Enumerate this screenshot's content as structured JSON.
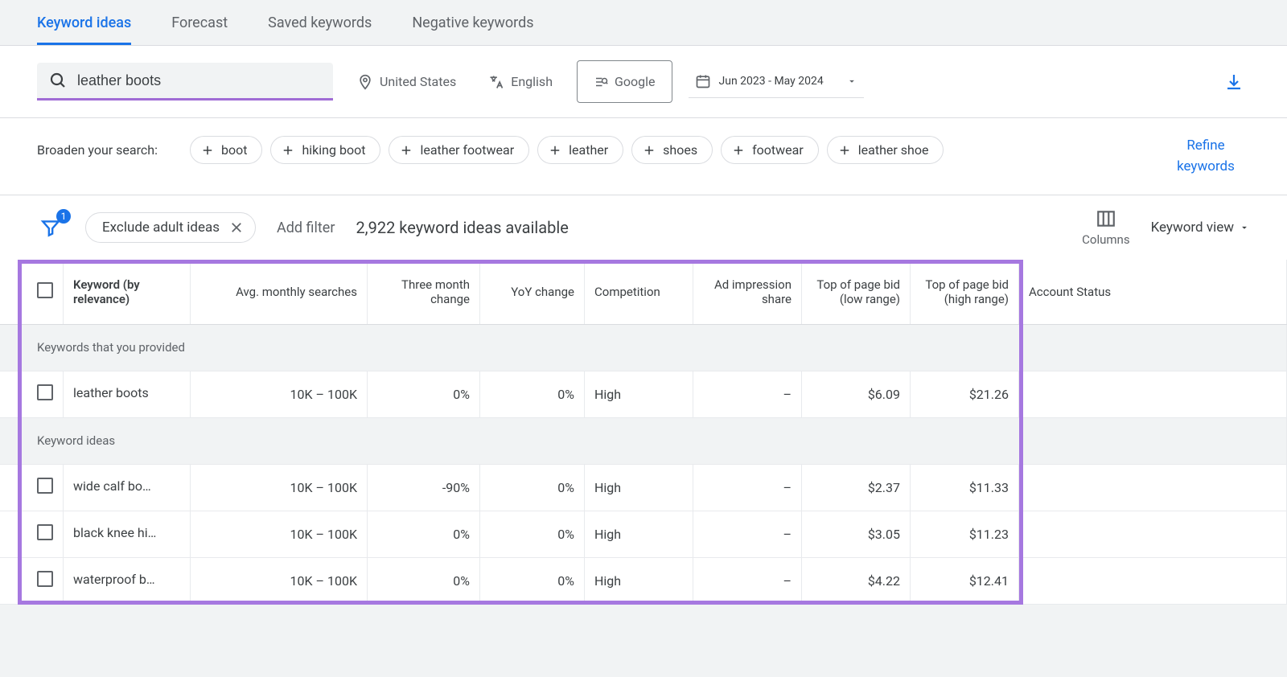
{
  "tabs": [
    {
      "label": "Keyword ideas",
      "active": true
    },
    {
      "label": "Forecast",
      "active": false
    },
    {
      "label": "Saved keywords",
      "active": false
    },
    {
      "label": "Negative keywords",
      "active": false
    }
  ],
  "search": {
    "value": "leather boots"
  },
  "filters": {
    "location": "United States",
    "language": "English",
    "network": "Google",
    "date_range": "Jun 2023 - May 2024"
  },
  "broaden": {
    "label": "Broaden your search:",
    "chips": [
      "boot",
      "hiking boot",
      "leather footwear",
      "leather",
      "shoes",
      "footwear",
      "leather shoe"
    ]
  },
  "refine_label": "Refine keywords",
  "toolbar": {
    "filter_badge": "1",
    "exclude_label": "Exclude adult ideas",
    "add_filter": "Add filter",
    "ideas_count": "2,922 keyword ideas available",
    "columns_label": "Columns",
    "view_label": "Keyword view"
  },
  "table": {
    "headers": {
      "keyword": "Keyword (by relevance)",
      "avg": "Avg. monthly searches",
      "three_month": "Three month change",
      "yoy": "YoY change",
      "competition": "Competition",
      "impression": "Ad impression share",
      "bid_low": "Top of page bid (low range)",
      "bid_high": "Top of page bid (high range)",
      "status": "Account Status"
    },
    "section1": "Keywords that you provided",
    "section2": "Keyword ideas",
    "rows_provided": [
      {
        "kw": "leather boots",
        "avg": "10K – 100K",
        "tm": "0%",
        "yoy": "0%",
        "comp": "High",
        "imp": "–",
        "low": "$6.09",
        "high": "$21.26"
      }
    ],
    "rows_ideas": [
      {
        "kw": "wide calf bo…",
        "avg": "10K – 100K",
        "tm": "-90%",
        "yoy": "0%",
        "comp": "High",
        "imp": "–",
        "low": "$2.37",
        "high": "$11.33"
      },
      {
        "kw": "black knee hi…",
        "avg": "10K – 100K",
        "tm": "0%",
        "yoy": "0%",
        "comp": "High",
        "imp": "–",
        "low": "$3.05",
        "high": "$11.23"
      },
      {
        "kw": "waterproof b…",
        "avg": "10K – 100K",
        "tm": "0%",
        "yoy": "0%",
        "comp": "High",
        "imp": "–",
        "low": "$4.22",
        "high": "$12.41"
      }
    ]
  }
}
